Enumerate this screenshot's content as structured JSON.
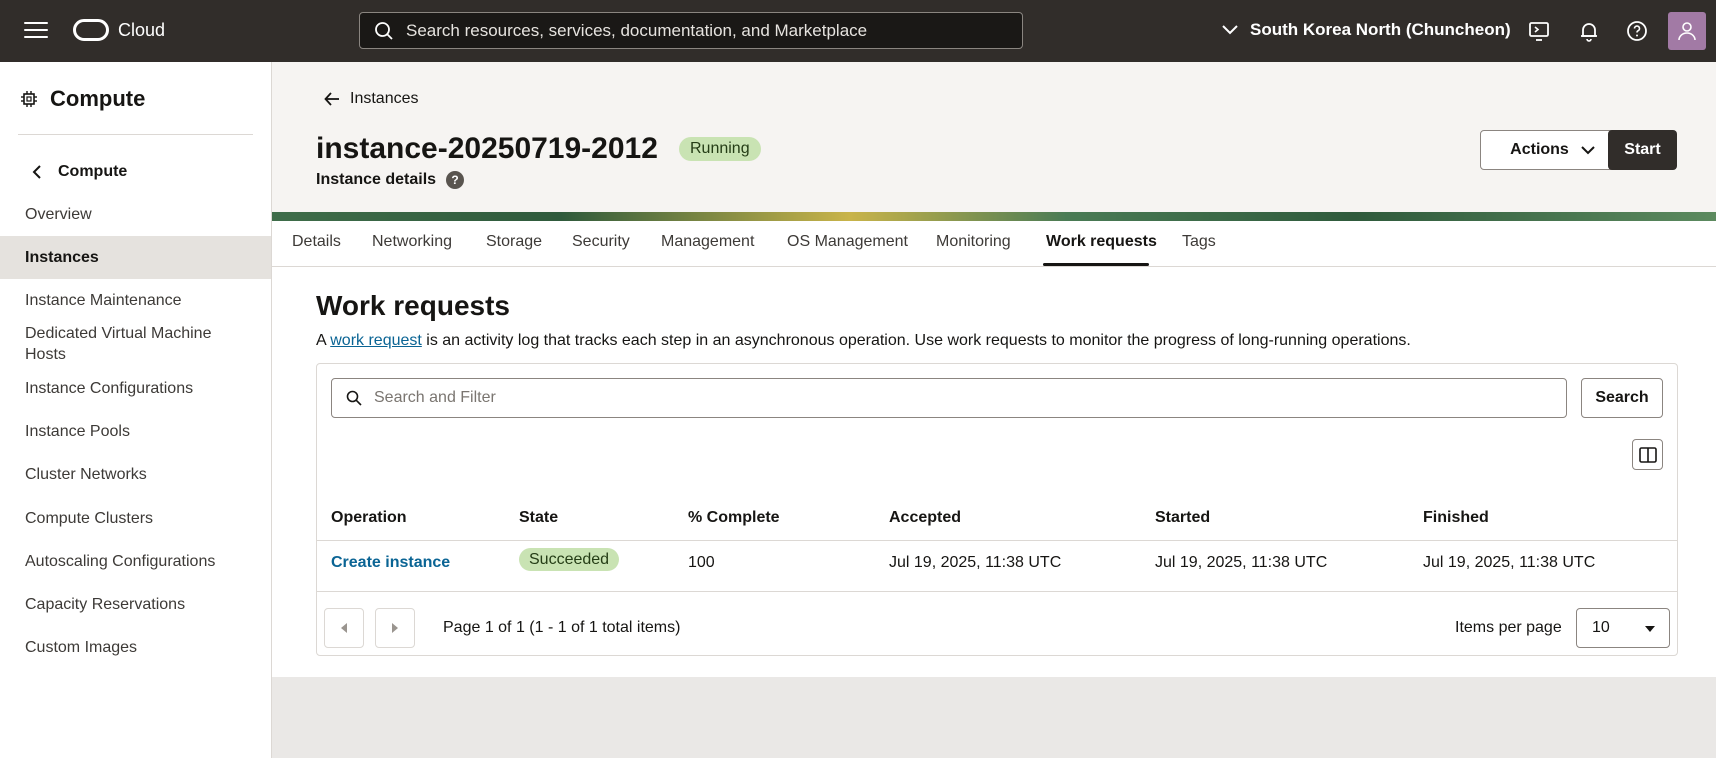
{
  "topbar": {
    "brand": "Cloud",
    "search_placeholder": "Search resources, services, documentation, and Marketplace",
    "region": "South Korea North (Chuncheon)"
  },
  "sidebar": {
    "title": "Compute",
    "back_label": "Compute",
    "items": [
      {
        "label": "Overview"
      },
      {
        "label": "Instances"
      },
      {
        "label": "Instance Maintenance"
      },
      {
        "label": "Dedicated Virtual Machine Hosts"
      },
      {
        "label": "Instance Configurations"
      },
      {
        "label": "Instance Pools"
      },
      {
        "label": "Cluster Networks"
      },
      {
        "label": "Compute Clusters"
      },
      {
        "label": "Autoscaling Configurations"
      },
      {
        "label": "Capacity Reservations"
      },
      {
        "label": "Custom Images"
      }
    ]
  },
  "header": {
    "breadcrumb": "Instances",
    "title": "instance-20250719-2012",
    "status": "Running",
    "subtitle": "Instance details",
    "help": "?",
    "actions_label": "Actions",
    "start_label": "Start"
  },
  "tabs": [
    "Details",
    "Networking",
    "Storage",
    "Security",
    "Management",
    "OS Management",
    "Monitoring",
    "Work requests",
    "Tags"
  ],
  "section": {
    "title": "Work requests",
    "desc_prefix": "A ",
    "desc_link": "work request",
    "desc_suffix": " is an activity log that tracks each step in an asynchronous operation. Use work requests to monitor the progress of long-running operations."
  },
  "filter": {
    "placeholder": "Search and Filter",
    "search_label": "Search"
  },
  "table": {
    "columns": [
      "Operation",
      "State",
      "% Complete",
      "Accepted",
      "Started",
      "Finished"
    ],
    "rows": [
      {
        "operation": "Create instance",
        "state": "Succeeded",
        "complete": "100",
        "accepted": "Jul 19, 2025, 11:38 UTC",
        "started": "Jul 19, 2025, 11:38 UTC",
        "finished": "Jul 19, 2025, 11:38 UTC"
      }
    ]
  },
  "pagination": {
    "text": "Page 1 of 1 (1 - 1 of 1 total items)",
    "items_per_page_label": "Items per page",
    "items_per_page_value": "10"
  },
  "colors": {
    "topbar": "#312d2a",
    "accent_link": "#0a6494",
    "success_badge": "#c9e3b3"
  }
}
